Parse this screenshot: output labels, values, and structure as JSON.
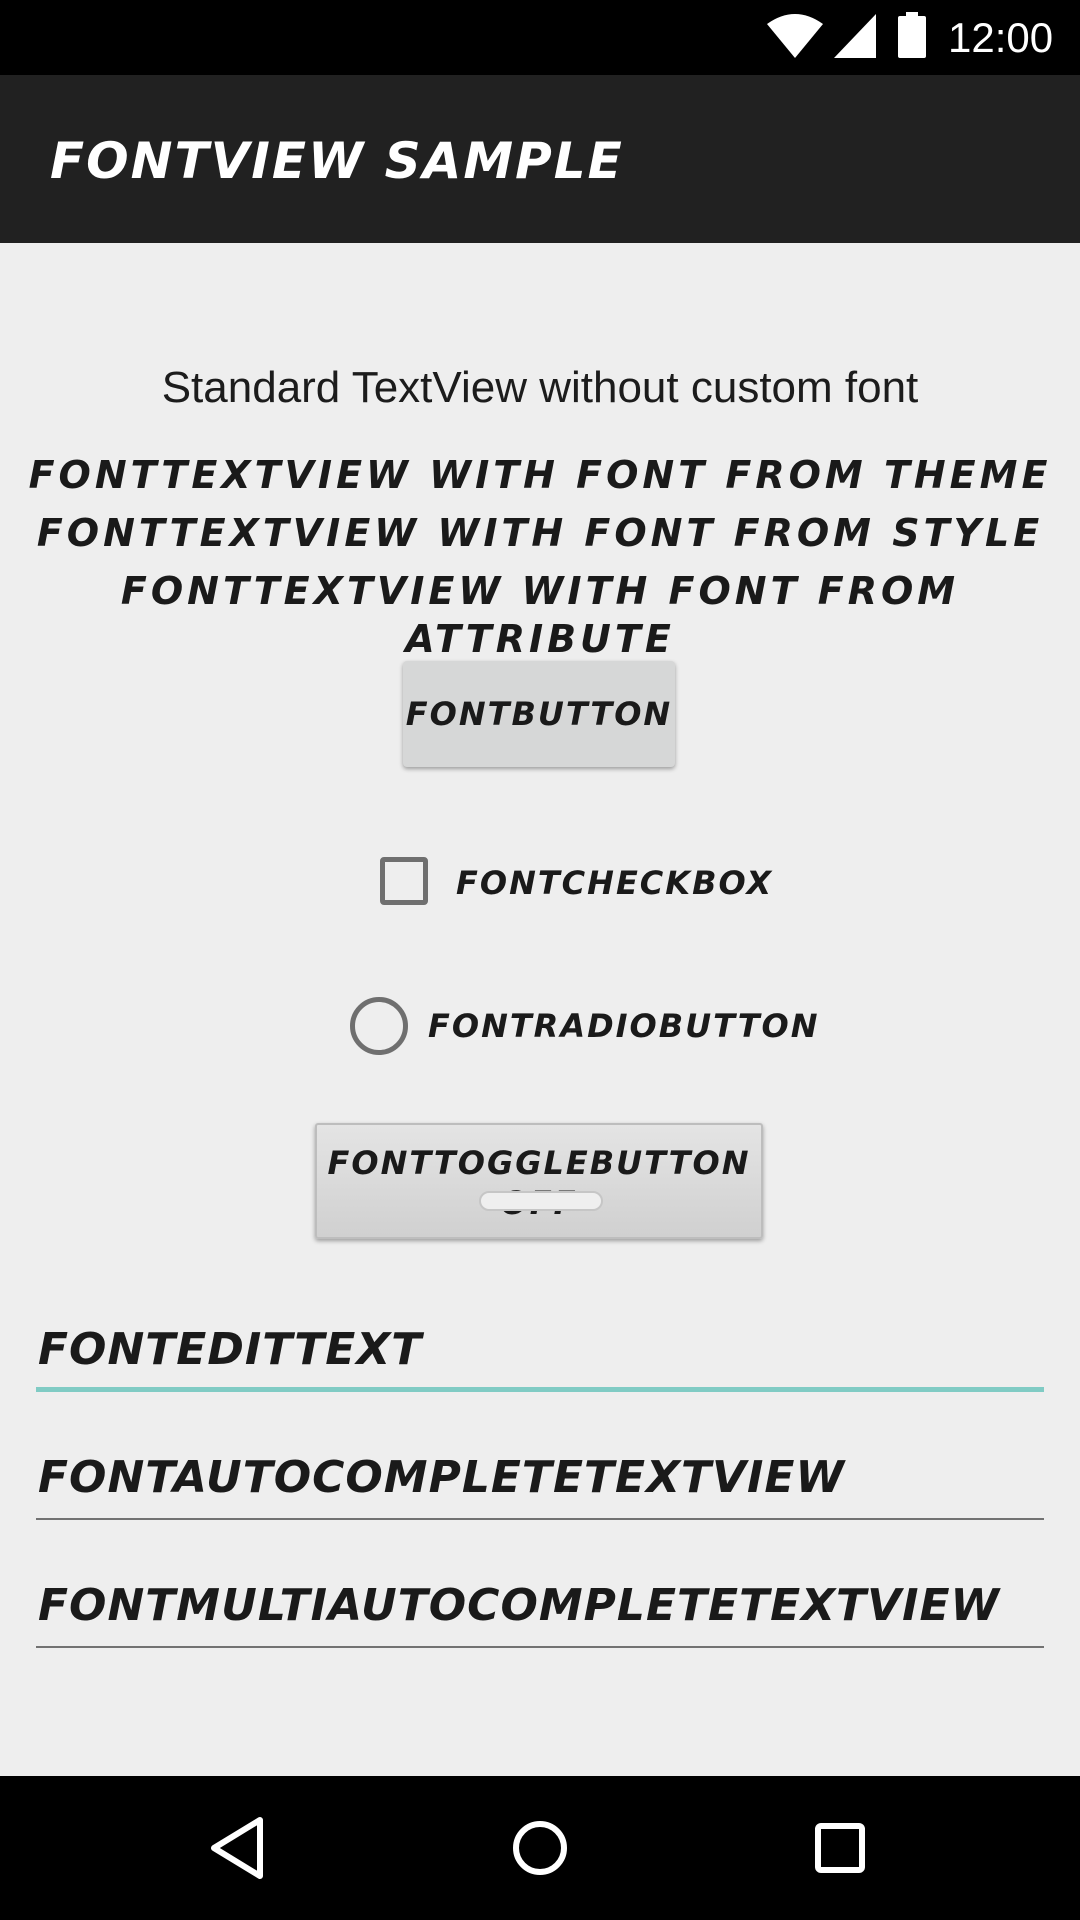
{
  "status_bar": {
    "time": "12:00",
    "icons": [
      "wifi-icon",
      "cell-signal-icon",
      "battery-icon"
    ]
  },
  "app_bar": {
    "title": "FontView Sample"
  },
  "main": {
    "standard_text": "Standard TextView without custom font",
    "font_text_theme": "FONTTEXTVIEW WITH FONT FROM THEME",
    "font_text_style": "FONTTEXTVIEW WITH FONT FROM STYLE",
    "font_text_attribute": "FONTTEXTVIEW WITH FONT FROM ATTRIBUTE",
    "font_button_label": "FONTBUTTON",
    "checkbox": {
      "label": "FONTCHECKBOX",
      "checked": false
    },
    "radio": {
      "label": "FONTRADIOBUTTON",
      "checked": false
    },
    "toggle": {
      "label": "FONTTOGGLEBUTTON OFF",
      "on": false
    },
    "edit_text_value": "FONTEDITTEXT",
    "autocomplete_value": "FONTAUTOCOMPLETETEXTVIEW",
    "multi_autocomplete_value": "FONTMULTIAUTOCOMPLETETEXTVIEW"
  },
  "colors": {
    "status_bar": "#000000",
    "app_bar": "#212121",
    "background": "#eeeeee",
    "accent": "#80cbc4",
    "nav_bar": "#000000"
  },
  "nav_bar": {
    "icons": [
      "back-icon",
      "home-icon",
      "recents-icon"
    ]
  }
}
